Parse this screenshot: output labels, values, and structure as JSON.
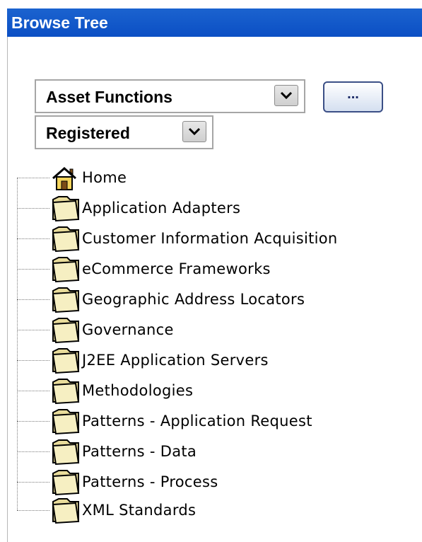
{
  "header": {
    "title": "Browse Tree"
  },
  "filters": {
    "functions_select": {
      "value": "Asset Functions"
    },
    "registered_select": {
      "value": "Registered"
    },
    "more_button": {
      "label": "..."
    }
  },
  "tree": {
    "items": [
      {
        "label": "Home",
        "icon": "home-icon"
      },
      {
        "label": "Application Adapters",
        "icon": "folder-icon"
      },
      {
        "label": "Customer Information Acquisition",
        "icon": "folder-icon"
      },
      {
        "label": "eCommerce Frameworks",
        "icon": "folder-icon"
      },
      {
        "label": "Geographic Address Locators",
        "icon": "folder-icon"
      },
      {
        "label": "Governance",
        "icon": "folder-icon"
      },
      {
        "label": "J2EE Application Servers",
        "icon": "folder-icon"
      },
      {
        "label": "Methodologies",
        "icon": "folder-icon"
      },
      {
        "label": "Patterns - Application Request",
        "icon": "folder-icon"
      },
      {
        "label": "Patterns - Data",
        "icon": "folder-icon"
      },
      {
        "label": "Patterns - Process",
        "icon": "folder-icon"
      },
      {
        "label": "XML Standards",
        "icon": "folder-icon"
      }
    ]
  }
}
